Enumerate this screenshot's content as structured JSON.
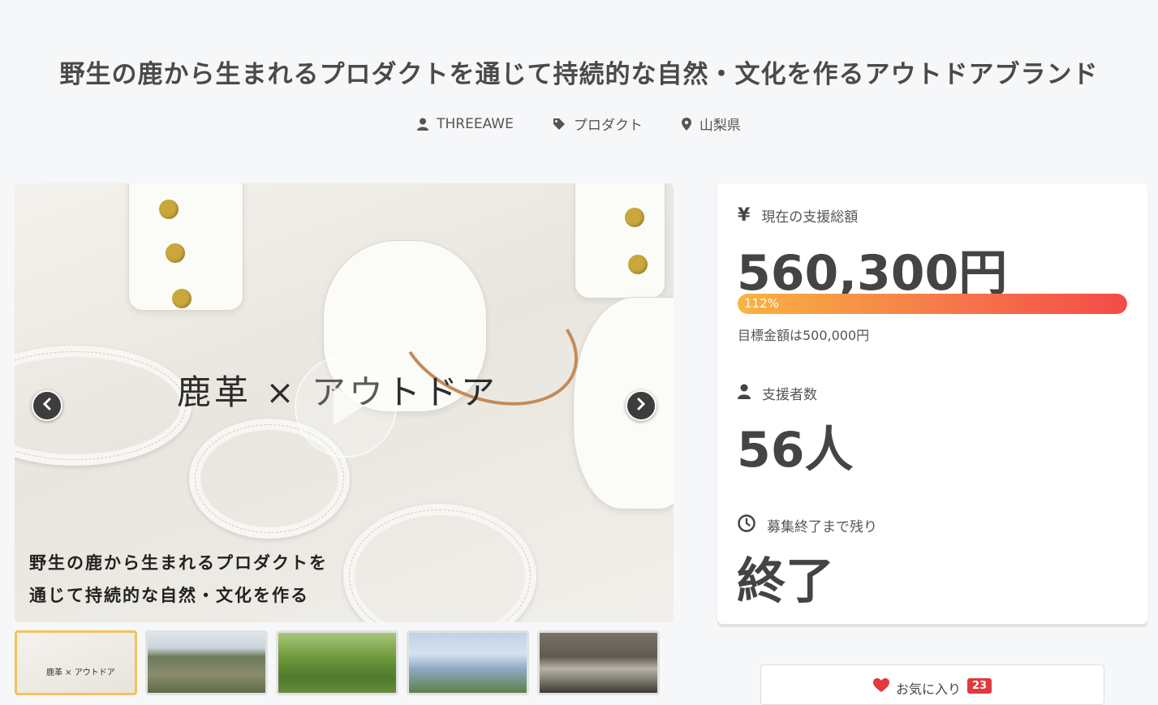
{
  "project": {
    "title": "野生の鹿から生まれるプロダクトを通じて持続的な自然・文化を作るアウトドアブランド",
    "owner": "THREEAWE",
    "category": "プロダクト",
    "location": "山梨県"
  },
  "hero": {
    "headline": "鹿革 × アウトドア",
    "caption_line1": "野生の鹿から生まれるプロダクトを",
    "caption_line2": "通じて持続的な自然・文化を作る",
    "thumb_text": "鹿革 × アウトドア"
  },
  "stats": {
    "amount_label": "現在の支援総額",
    "amount_value": "560,300円",
    "progress_text": "112%",
    "progress_fraction": 1.0,
    "goal_text": "目標金額は500,000円",
    "supporters_label": "支援者数",
    "supporters_value": "56人",
    "remaining_label": "募集終了まで残り",
    "remaining_value": "終了"
  },
  "favorite": {
    "label": "お気に入り",
    "count": "23"
  },
  "icons": {
    "yen": "¥"
  }
}
